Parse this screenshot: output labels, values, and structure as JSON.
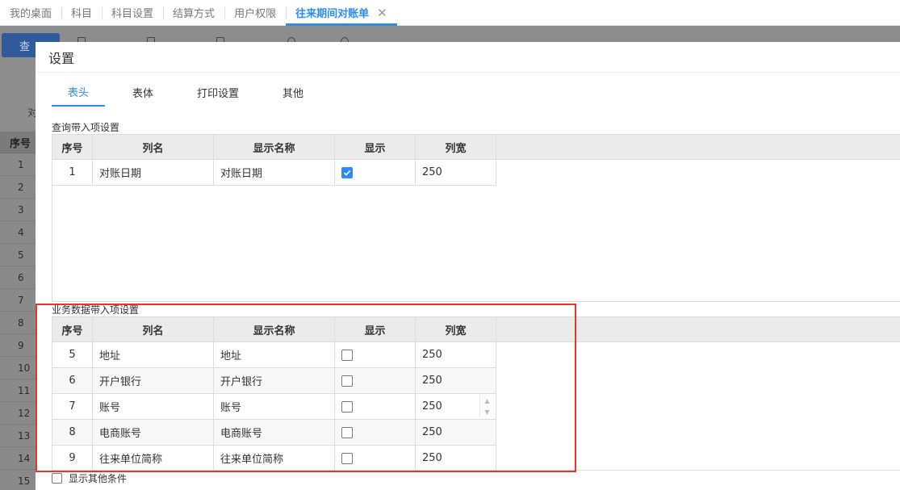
{
  "top_tabs": [
    {
      "label": "我的桌面"
    },
    {
      "label": "科目"
    },
    {
      "label": "科目设置"
    },
    {
      "label": "结算方式"
    },
    {
      "label": "用户权限"
    },
    {
      "label": "往来期间对账单",
      "active": true
    }
  ],
  "background": {
    "query_label": "查",
    "dui_label": "对",
    "num_header": "序号",
    "row_numbers": [
      "1",
      "2",
      "3",
      "4",
      "5",
      "6",
      "7",
      "8",
      "9",
      "10",
      "11",
      "12",
      "13",
      "14",
      "15"
    ]
  },
  "modal": {
    "title": "设置",
    "tabs": [
      {
        "label": "表头",
        "active": true
      },
      {
        "label": "表体"
      },
      {
        "label": "打印设置"
      },
      {
        "label": "其他"
      }
    ],
    "columns": [
      "序号",
      "列名",
      "显示名称",
      "显示",
      "列宽"
    ],
    "query_section": {
      "label": "查询带入项设置",
      "rows": [
        {
          "no": "1",
          "name": "对账日期",
          "display": "对账日期",
          "checked": true,
          "width": "250"
        }
      ]
    },
    "business_section": {
      "label": "业务数据带入项设置",
      "rows": [
        {
          "no": "5",
          "name": "地址",
          "display": "地址",
          "checked": false,
          "width": "250"
        },
        {
          "no": "6",
          "name": "开户银行",
          "display": "开户银行",
          "checked": false,
          "width": "250"
        },
        {
          "no": "7",
          "name": "账号",
          "display": "账号",
          "checked": false,
          "width": "250"
        },
        {
          "no": "8",
          "name": "电商账号",
          "display": "电商账号",
          "checked": false,
          "width": "250"
        },
        {
          "no": "9",
          "name": "往来单位简称",
          "display": "往来单位简称",
          "checked": false,
          "width": "250"
        }
      ]
    },
    "bottom_option": "显示其他条件"
  },
  "colors": {
    "accent": "#2d8cf0",
    "highlight": "#e8342c"
  }
}
